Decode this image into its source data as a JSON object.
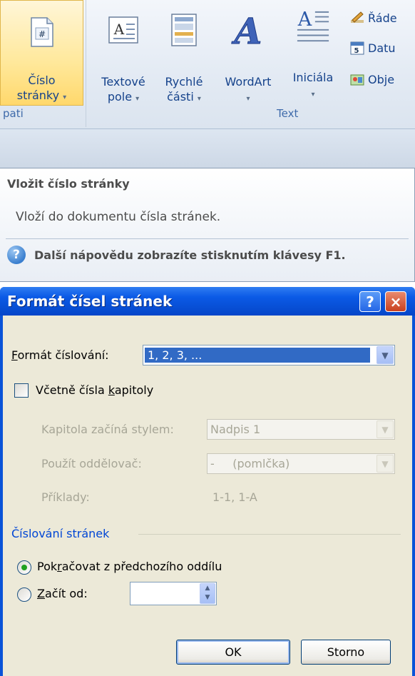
{
  "ribbon": {
    "page_number": {
      "line1": "Číslo",
      "line2": "stránky",
      "dropdown": "▾"
    },
    "textbox": {
      "line1": "Textové",
      "line2": "pole",
      "dropdown": "▾"
    },
    "quick_parts": {
      "line1": "Rychlé",
      "line2": "části",
      "dropdown": "▾"
    },
    "wordart": {
      "line1": "WordArt",
      "dropdown": "▾"
    },
    "dropcap": {
      "line1": "Iniciála",
      "dropdown": "▾"
    },
    "small_items": [
      "Řáde",
      "Datu",
      "Obje"
    ],
    "group_left": "pati",
    "group_text": "Text"
  },
  "tooltip": {
    "title": "Vložit číslo stránky",
    "description": "Vloží do dokumentu čísla stránek.",
    "help_text": "Další nápovědu zobrazíte stisknutím klávesy F1."
  },
  "dialog": {
    "title": "Formát čísel stránek",
    "help_button": "?",
    "close_button": "×",
    "number_format_label_key": "F",
    "number_format_label_rest": "ormát číslování:",
    "number_format_value": "1, 2, 3, ...",
    "include_chapter_pre": "Včetně čísla ",
    "include_chapter_key": "k",
    "include_chapter_post": "apitoly",
    "include_chapter_checked": false,
    "chapter_style_label": "Kapitola začíná stylem:",
    "chapter_style_value": "Nadpis 1",
    "separator_label": "Použít oddělovač:",
    "separator_value": "-     (pomlčka)",
    "examples_label": "Příklady:",
    "examples_value": "1-1, 1-A",
    "page_numbering_group": "Číslování stránek",
    "continue_pre": "Pok",
    "continue_key": "r",
    "continue_post": "ačovat z předchozího oddílu",
    "continue_selected": true,
    "start_at_key": "Z",
    "start_at_rest": "ačít od:",
    "start_at_value": "",
    "ok": "OK",
    "cancel": "Storno"
  }
}
